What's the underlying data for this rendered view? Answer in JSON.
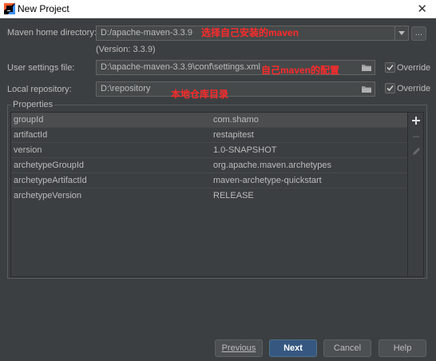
{
  "window": {
    "title": "New Project",
    "close_symbol": "✕"
  },
  "maven_home": {
    "label": "Maven home directory:",
    "value": "D:/apache-maven-3.3.9",
    "version": "(Version: 3.3.9)",
    "browse_label": "...",
    "annotation": "选择自己安装的maven"
  },
  "user_settings": {
    "label": "User settings file:",
    "value": "D:\\apache-maven-3.3.9\\conf\\settings.xml",
    "override_label": "Override",
    "override_checked": true,
    "annotation": "自己maven的配置"
  },
  "local_repo": {
    "label": "Local repository:",
    "value": "D:\\repository",
    "override_label": "Override",
    "override_checked": true,
    "annotation": "本地仓库目录"
  },
  "properties": {
    "legend": "Properties",
    "rows": [
      {
        "key": "groupId",
        "value": "com.shamo"
      },
      {
        "key": "artifactId",
        "value": "restapitest"
      },
      {
        "key": "version",
        "value": "1.0-SNAPSHOT"
      },
      {
        "key": "archetypeGroupId",
        "value": "org.apache.maven.archetypes"
      },
      {
        "key": "archetypeArtifactId",
        "value": "maven-archetype-quickstart"
      },
      {
        "key": "archetypeVersion",
        "value": "RELEASE"
      }
    ],
    "add_icon": "plus-icon",
    "remove_icon": "minus-icon",
    "edit_icon": "pencil-icon"
  },
  "buttons": {
    "previous": "Previous",
    "next": "Next",
    "cancel": "Cancel",
    "help": "Help"
  },
  "colors": {
    "background": "#3c3f41",
    "annotation": "#ff2a2a",
    "primary_button": "#365880"
  }
}
